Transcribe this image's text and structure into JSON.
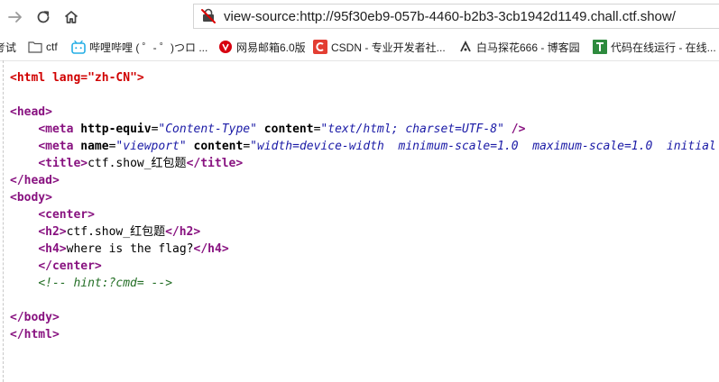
{
  "toolbar": {
    "url_scheme": "view-source:",
    "url": "http://95f30eb9-057b-4460-b2b3-3cb1942d1149.chall.ctf.show/",
    "icons": {
      "forward": "arrow-right-icon",
      "reload": "reload-icon",
      "home": "home-icon",
      "insecure": "not-secure-icon"
    }
  },
  "bookmarks": [
    {
      "label": "考试",
      "icon": "none"
    },
    {
      "label": "ctf",
      "icon": "folder-icon"
    },
    {
      "label": "哔哩哔哩 ( ゜- ゜)つロ ...",
      "icon": "bilibili-icon"
    },
    {
      "label": "网易邮箱6.0版",
      "icon": "netease-icon"
    },
    {
      "label": "CSDN - 专业开发者社...",
      "icon": "csdn-icon"
    },
    {
      "label": "白马探花666 - 博客园",
      "icon": "cnblogs-icon"
    },
    {
      "label": "代码在线运行 - 在线...",
      "icon": "code-run-icon"
    }
  ],
  "source": {
    "lines": [
      [
        {
          "t": "<html ",
          "c": "tag-red"
        },
        {
          "t": "lang",
          "c": "tag-red"
        },
        {
          "t": "=\"zh-CN\">",
          "c": "tag-red"
        }
      ],
      [],
      [
        {
          "t": "<head>",
          "c": "tag"
        }
      ],
      [
        {
          "t": "    "
        },
        {
          "t": "<meta ",
          "c": "tag"
        },
        {
          "t": "http-equiv",
          "c": "attr"
        },
        {
          "t": "=",
          "c": "txt"
        },
        {
          "t": "\"Content-Type\"",
          "c": "val"
        },
        {
          "t": " content",
          "c": "attr"
        },
        {
          "t": "=",
          "c": "txt"
        },
        {
          "t": "\"text/html; charset=UTF-8\"",
          "c": "val"
        },
        {
          "t": " />",
          "c": "tag"
        }
      ],
      [
        {
          "t": "    "
        },
        {
          "t": "<meta ",
          "c": "tag"
        },
        {
          "t": "name",
          "c": "attr"
        },
        {
          "t": "=",
          "c": "txt"
        },
        {
          "t": "\"viewport\"",
          "c": "val"
        },
        {
          "t": " content",
          "c": "attr"
        },
        {
          "t": "=",
          "c": "txt"
        },
        {
          "t": "\"width=device-width  minimum-scale=1.0  maximum-scale=1.0  initial",
          "c": "val"
        }
      ],
      [
        {
          "t": "    "
        },
        {
          "t": "<title>",
          "c": "tag"
        },
        {
          "t": "ctf.show_红包题",
          "c": "txt"
        },
        {
          "t": "</title>",
          "c": "tag"
        }
      ],
      [
        {
          "t": "</head>",
          "c": "tag"
        }
      ],
      [
        {
          "t": "<body>",
          "c": "tag"
        }
      ],
      [
        {
          "t": "    "
        },
        {
          "t": "<center>",
          "c": "tag"
        }
      ],
      [
        {
          "t": "    "
        },
        {
          "t": "<h2>",
          "c": "tag"
        },
        {
          "t": "ctf.show_红包题",
          "c": "txt"
        },
        {
          "t": "</h2>",
          "c": "tag"
        }
      ],
      [
        {
          "t": "    "
        },
        {
          "t": "<h4>",
          "c": "tag"
        },
        {
          "t": "where is the flag?",
          "c": "txt"
        },
        {
          "t": "</h4>",
          "c": "tag"
        }
      ],
      [
        {
          "t": "    "
        },
        {
          "t": "</center>",
          "c": "tag"
        }
      ],
      [
        {
          "t": "    "
        },
        {
          "t": "<!-- hint:?cmd= -->",
          "c": "cmt"
        }
      ],
      [],
      [
        {
          "t": "</body>",
          "c": "tag"
        }
      ],
      [
        {
          "t": "</html>",
          "c": "tag"
        }
      ]
    ]
  }
}
